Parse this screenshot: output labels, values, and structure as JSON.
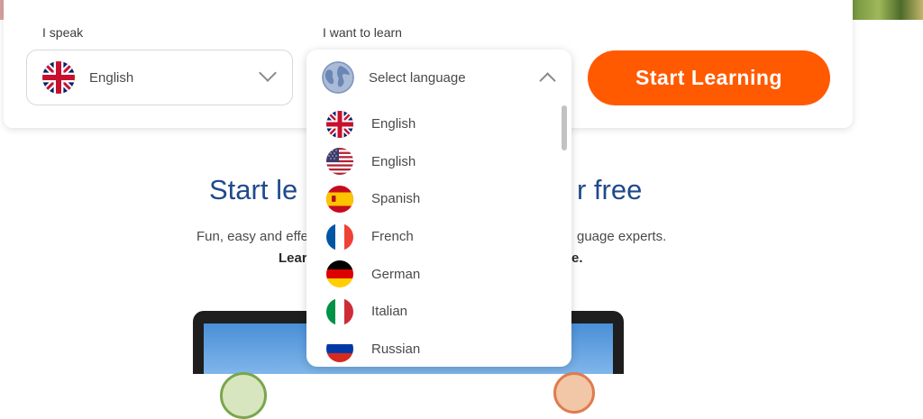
{
  "selector": {
    "speak_label": "I speak",
    "learn_label": "I want to learn",
    "speak_value": "English",
    "learn_placeholder": "Select language",
    "start_button": "Start Learning"
  },
  "dropdown": {
    "options": [
      {
        "label": "English",
        "flag": "uk-flag-icon"
      },
      {
        "label": "English",
        "flag": "us-flag-icon"
      },
      {
        "label": "Spanish",
        "flag": "spain-flag-icon"
      },
      {
        "label": "French",
        "flag": "france-flag-icon"
      },
      {
        "label": "German",
        "flag": "germany-flag-icon"
      },
      {
        "label": "Italian",
        "flag": "italy-flag-icon"
      },
      {
        "label": "Russian",
        "flag": "russia-flag-icon"
      }
    ]
  },
  "hero": {
    "title_left": "Start le",
    "title_right": "r free",
    "sub_left": "Fun, easy and effe",
    "sub_right": "guage experts.",
    "bold_left": "Lear",
    "bold_right": "e."
  },
  "colors": {
    "accent": "#ff5a00",
    "title": "#1f4a8c"
  }
}
